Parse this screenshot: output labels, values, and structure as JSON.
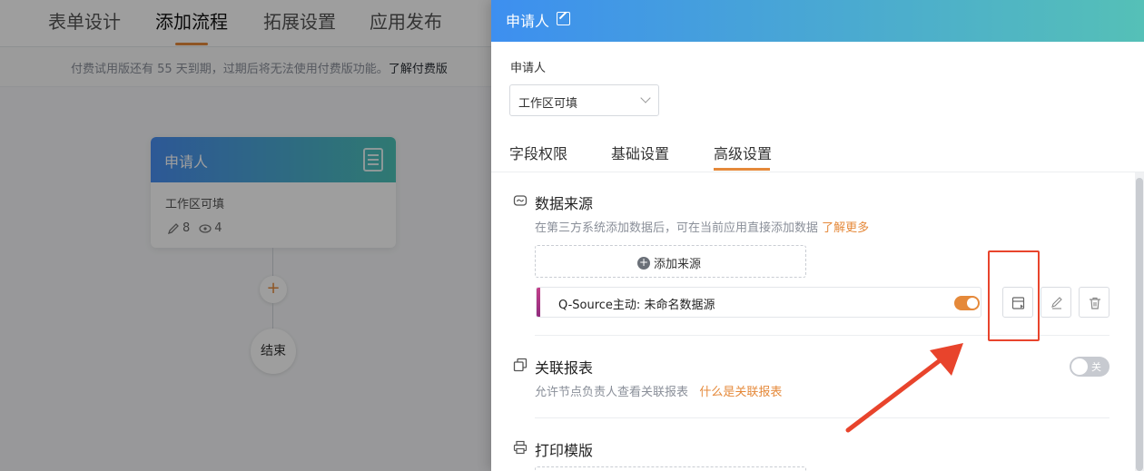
{
  "background": {
    "tabs": [
      "表单设计",
      "添加流程",
      "拓展设置",
      "应用发布"
    ],
    "active_tab": "添加流程",
    "trial_notice": "付费试用版还有 55 天到期，过期后将无法使用付费版功能。",
    "trial_link": "了解付费版",
    "flow_card": {
      "title": "申请人",
      "subtitle": "工作区可填",
      "edit_count": "8",
      "view_count": "4"
    },
    "add_node": "+",
    "end_node": "结束"
  },
  "drawer": {
    "title": "申请人",
    "field_label": "申请人",
    "select_value": "工作区可填",
    "tabs": [
      "字段权限",
      "基础设置",
      "高级设置"
    ],
    "active_tab": "高级设置",
    "data_source": {
      "title": "数据来源",
      "desc": "在第三方系统添加数据后，可在当前应用直接添加数据",
      "link": "了解更多",
      "add_button": "添加来源",
      "sources": [
        {
          "name": "Q-Source主动: 未命名数据源",
          "enabled": true
        }
      ]
    },
    "linked_report": {
      "title": "关联报表",
      "desc": "允许节点负责人查看关联报表",
      "link": "什么是关联报表",
      "toggle_label": "关",
      "enabled": false
    },
    "print_template": {
      "title": "打印模版"
    }
  },
  "colors": {
    "accent": "#e5893a",
    "annotation_red": "#e8442c",
    "header_gradient_start": "#3d8ff0",
    "header_gradient_end": "#55c0b7"
  }
}
